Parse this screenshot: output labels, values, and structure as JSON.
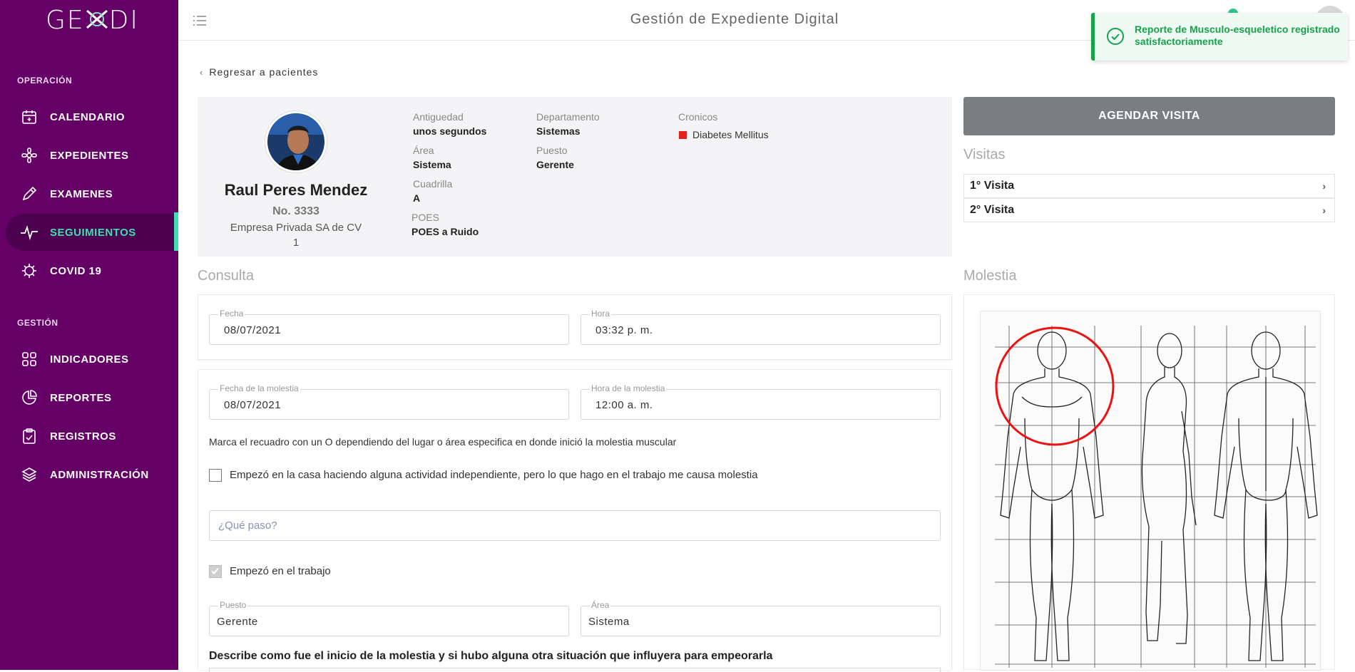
{
  "app": {
    "logo": "GEXDI",
    "page_title": "Gestión de Expediente Digital"
  },
  "sidebar": {
    "section_operacion": "OPERACIÓN",
    "section_gestion": "GESTIÓN",
    "items": [
      {
        "label": "CALENDARIO",
        "icon": "calendar-icon"
      },
      {
        "label": "EXPEDIENTES",
        "icon": "flower-icon"
      },
      {
        "label": "EXAMENES",
        "icon": "pencil-icon"
      },
      {
        "label": "SEGUIMIENTOS",
        "icon": "pulse-icon",
        "active": true
      },
      {
        "label": "COVID 19",
        "icon": "virus-icon"
      },
      {
        "label": "INDICADORES",
        "icon": "grid-icon"
      },
      {
        "label": "REPORTES",
        "icon": "pie-chart-icon"
      },
      {
        "label": "REGISTROS",
        "icon": "clipboard-icon"
      },
      {
        "label": "ADMINISTRACIÓN",
        "icon": "layers-icon"
      }
    ]
  },
  "toast": {
    "message": "Reporte de Musculo-esqueletico registrado satisfactoriamente",
    "icon": "check-circle-icon"
  },
  "back_link": "Regresar a pacientes",
  "patient": {
    "name": "Raul Peres Mendez",
    "number": "No. 3333",
    "company": "Empresa Privada SA de CV",
    "extra": "1",
    "fields": {
      "antiguedad_label": "Antiguedad",
      "antiguedad": "unos segundos",
      "area_label": "Área",
      "area": "Sistema",
      "cuadrilla_label": "Cuadrilla",
      "cuadrilla": "A",
      "poes_label": "POES",
      "poes": "POES a Ruido",
      "departamento_label": "Departamento",
      "departamento": "Sistemas",
      "puesto_label": "Puesto",
      "puesto": "Gerente",
      "cronicos_label": "Cronicos",
      "cronico": "Diabetes Mellitus"
    }
  },
  "actions": {
    "agendar": "AGENDAR VISITA"
  },
  "visitas": {
    "title": "Visitas",
    "items": [
      "1° Visita",
      "2° Visita"
    ]
  },
  "consulta": {
    "title": "Consulta",
    "fecha_label": "Fecha",
    "fecha": "08/07/2021",
    "hora_label": "Hora",
    "hora": "03:32 p. m."
  },
  "molestia_form": {
    "fecha_label": "Fecha de la molestia",
    "fecha": "08/07/2021",
    "hora_label": "Hora de la molestia",
    "hora": "12:00 a. m.",
    "instruction": "Marca el recuadro con un O dependiendo del lugar o área especifica en donde inició la molestia muscular",
    "casa_label": "Empezó en la casa haciendo alguna actividad independiente, pero lo que hago en el trabajo me causa molestia",
    "casa_checked": false,
    "que_paso_placeholder": "¿Qué paso?",
    "trabajo_label": "Empezó en el trabajo",
    "trabajo_checked": true,
    "puesto_label": "Puesto",
    "puesto": "Gerente",
    "area_label": "Área",
    "area": "Sistema",
    "describe_label": "Describe como fue el inicio de la molestia y si hubo alguna otra situación que influyera para empeorarla"
  },
  "molestia": {
    "title": "Molestia"
  }
}
